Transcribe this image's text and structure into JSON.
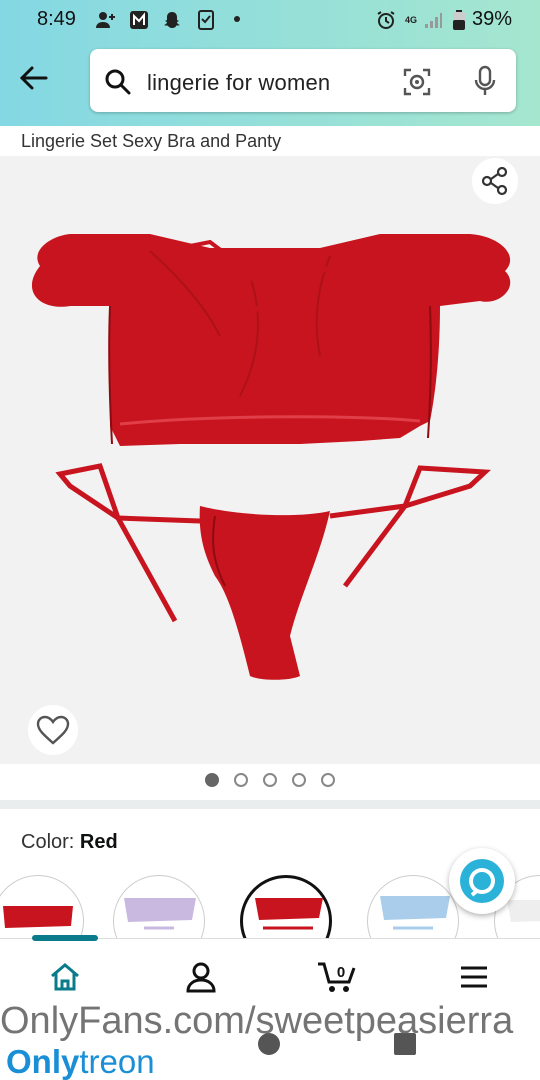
{
  "status": {
    "time": "8:49",
    "battery": "39%",
    "network": "4G LTE"
  },
  "search": {
    "query": "lingerie for women",
    "back_icon": "back-arrow-icon",
    "search_icon": "search-icon",
    "camera_icon": "camera-lens-icon",
    "mic_icon": "microphone-icon"
  },
  "product": {
    "title": "Lingerie Set Sexy Bra and Panty",
    "image_count": 5,
    "current_image": 1
  },
  "variation": {
    "color_label": "Color:",
    "color_value": "Red",
    "swatches": [
      "Red",
      "Lavender",
      "Red",
      "Light Blue",
      "White"
    ],
    "selected_index": 2
  },
  "bottom_nav": [
    "home-icon",
    "account-icon",
    "cart-icon",
    "menu-icon"
  ],
  "cart_count": "0",
  "watermark": {
    "url": "OnlyFans.com/sweetpeasierra",
    "brand_a": "Only",
    "brand_b": "treon"
  },
  "colors": {
    "accent": "#0a7b8a",
    "product_red": "#c8141e",
    "header_gradient_start": "#84d8e3",
    "header_gradient_end": "#a5e6cf"
  }
}
